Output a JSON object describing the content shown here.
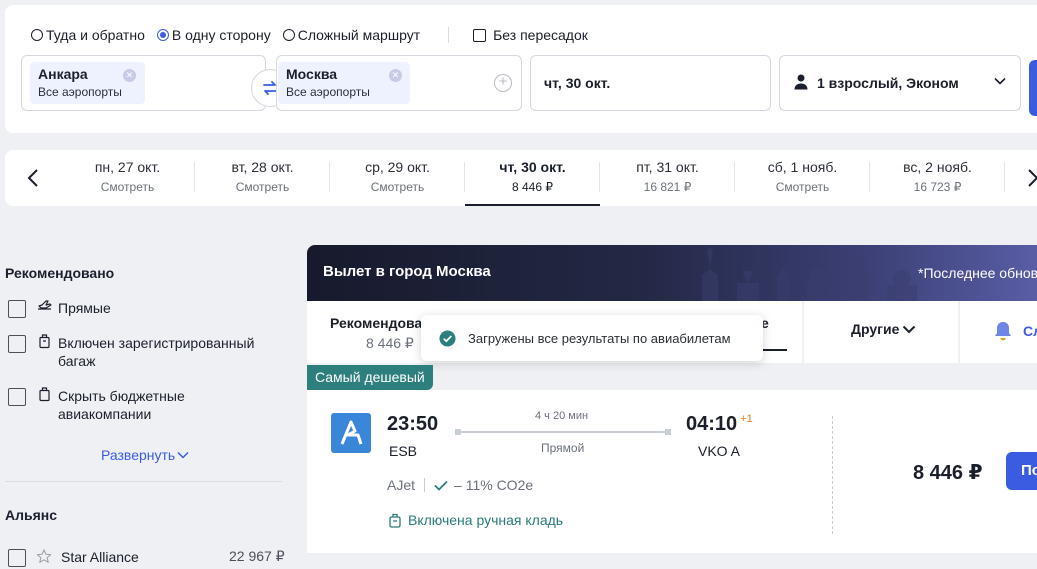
{
  "search": {
    "trip_types": [
      {
        "label": "Туда и обратно",
        "selected": false
      },
      {
        "label": "В одну сторону",
        "selected": true
      },
      {
        "label": "Сложный маршрут",
        "selected": false
      }
    ],
    "nonstop_label": "Без пересадок",
    "origin": {
      "city": "Анкара",
      "airports": "Все аэропорты"
    },
    "destination": {
      "city": "Москва",
      "airports": "Все аэропорты"
    },
    "date": "чт, 30 окт.",
    "passengers": "1 взрослый, Эконом"
  },
  "date_strip": [
    {
      "day": "пн, 27 окт.",
      "price": "Смотреть",
      "active": false
    },
    {
      "day": "вт, 28 окт.",
      "price": "Смотреть",
      "active": false
    },
    {
      "day": "ср, 29 окт.",
      "price": "Смотреть",
      "active": false
    },
    {
      "day": "чт, 30 окт.",
      "price": "8 446 ₽",
      "active": true
    },
    {
      "day": "пт, 31 окт.",
      "price": "16 821 ₽",
      "active": false
    },
    {
      "day": "сб, 1 нояб.",
      "price": "Смотреть",
      "active": false
    },
    {
      "day": "вс, 2 нояб.",
      "price": "16 723 ₽",
      "active": false
    }
  ],
  "filters": {
    "recommended_title": "Рекомендовано",
    "items": [
      {
        "label": "Прямые",
        "icon": "plane-icon"
      },
      {
        "label": "Включен зарегистрированный багаж",
        "icon": "luggage-icon"
      },
      {
        "label": "Скрыть бюджетные авиакомпании",
        "icon": "budget-icon"
      }
    ],
    "expand_label": "Развернуть",
    "alliance_title": "Альянс",
    "alliance_items": [
      {
        "label": "Star Alliance",
        "price": "22 967 ₽"
      }
    ]
  },
  "results": {
    "banner_title": "Вылет в город Москва",
    "banner_note": "*Последнее обновление",
    "sort": {
      "recommended": {
        "label": "Рекомендовано",
        "price": "8 446 ₽"
      },
      "third_label": "е",
      "other_label": "Другие",
      "subscribe_label": "Сл"
    },
    "toast": "Загружены все результаты по авиабилетам",
    "badge": "Самый дешевый",
    "ticket": {
      "depart_time": "23:50",
      "depart_airport": "ESB",
      "duration": "4 ч 20 мин",
      "stops": "Прямой",
      "arrive_time": "04:10",
      "day_offset": "+1",
      "arrive_airport": "VKO A",
      "airline": "AJet",
      "co2": "– 11% CO2e",
      "baggage": "Включена ручная кладь",
      "price": "8 446 ₽",
      "buy_label": "По"
    }
  }
}
